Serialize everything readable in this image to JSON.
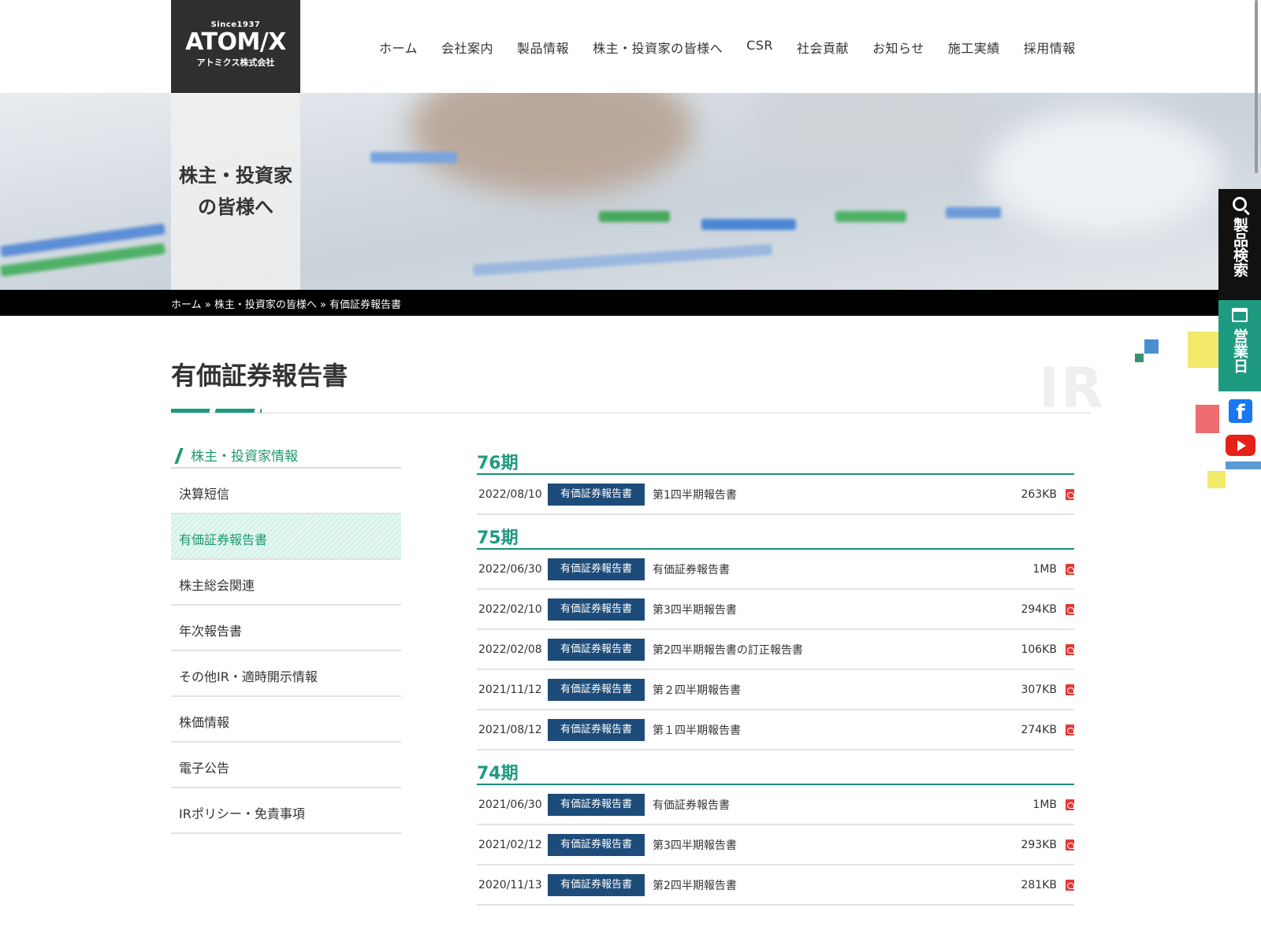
{
  "logo": {
    "since": "Since1937",
    "mark": "ATOM/X",
    "sub": "アトミクス株式会社"
  },
  "nav": [
    "ホーム",
    "会社案内",
    "製品情報",
    "株主・投資家の皆様へ",
    "CSR",
    "社会貢献",
    "お知らせ",
    "施工実績",
    "採用情報"
  ],
  "hero": {
    "line1": "株主・投資家",
    "line2": "の皆様へ"
  },
  "breadcrumb": "ホーム » 株主・投資家の皆様へ » 有価証券報告書",
  "page_title": "有価証券報告書",
  "page_title_bg": "IR",
  "sidebar": {
    "heading": "株主・投資家情報",
    "items": [
      {
        "label": "決算短信",
        "active": false
      },
      {
        "label": "有価証券報告書",
        "active": true
      },
      {
        "label": "株主総会関連",
        "active": false
      },
      {
        "label": "年次報告書",
        "active": false
      },
      {
        "label": "その他IR・適時開示情報",
        "active": false
      },
      {
        "label": "株価情報",
        "active": false
      },
      {
        "label": "電子公告",
        "active": false
      },
      {
        "label": "IRポリシー・免責事項",
        "active": false
      }
    ]
  },
  "periods": [
    {
      "title": "76期",
      "docs": [
        {
          "date": "2022/08/10",
          "tag": "有価証券報告書",
          "title": "第1四半期報告書",
          "size": "263KB"
        }
      ]
    },
    {
      "title": "75期",
      "docs": [
        {
          "date": "2022/06/30",
          "tag": "有価証券報告書",
          "title": "有価証券報告書",
          "size": "1MB"
        },
        {
          "date": "2022/02/10",
          "tag": "有価証券報告書",
          "title": "第3四半期報告書",
          "size": "294KB"
        },
        {
          "date": "2022/02/08",
          "tag": "有価証券報告書",
          "title": "第2四半期報告書の訂正報告書",
          "size": "106KB"
        },
        {
          "date": "2021/11/12",
          "tag": "有価証券報告書",
          "title": "第２四半期報告書",
          "size": "307KB"
        },
        {
          "date": "2021/08/12",
          "tag": "有価証券報告書",
          "title": "第１四半期報告書",
          "size": "274KB"
        }
      ]
    },
    {
      "title": "74期",
      "docs": [
        {
          "date": "2021/06/30",
          "tag": "有価証券報告書",
          "title": "有価証券報告書",
          "size": "1MB"
        },
        {
          "date": "2021/02/12",
          "tag": "有価証券報告書",
          "title": "第3四半期報告書",
          "size": "293KB"
        },
        {
          "date": "2020/11/13",
          "tag": "有価証券報告書",
          "title": "第2四半期報告書",
          "size": "281KB"
        }
      ]
    }
  ],
  "side_tabs": {
    "search": "製品検索",
    "calendar": "営業日"
  },
  "social": {
    "facebook": "f"
  },
  "colors": {
    "accent": "#1e9a80",
    "tag_bg": "#1d4c7a",
    "pdf": "#e53935"
  }
}
